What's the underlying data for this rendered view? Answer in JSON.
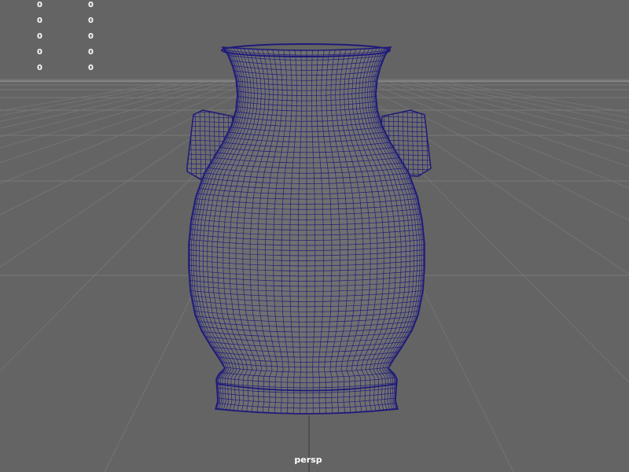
{
  "viewport": {
    "camera_label": "persp",
    "background_color": "#646464",
    "wireframe_color": "#1e1a7a",
    "grid_color": "#7a7a7a",
    "axis_color": "#2a2a2a"
  },
  "hud": {
    "rows": [
      {
        "col1": "0",
        "col2": "0"
      },
      {
        "col1": "0",
        "col2": "0"
      },
      {
        "col1": "0",
        "col2": "0"
      },
      {
        "col1": "0",
        "col2": "0"
      },
      {
        "col1": "0",
        "col2": "0"
      }
    ]
  },
  "model": {
    "icon": "vase-mesh-icon"
  }
}
